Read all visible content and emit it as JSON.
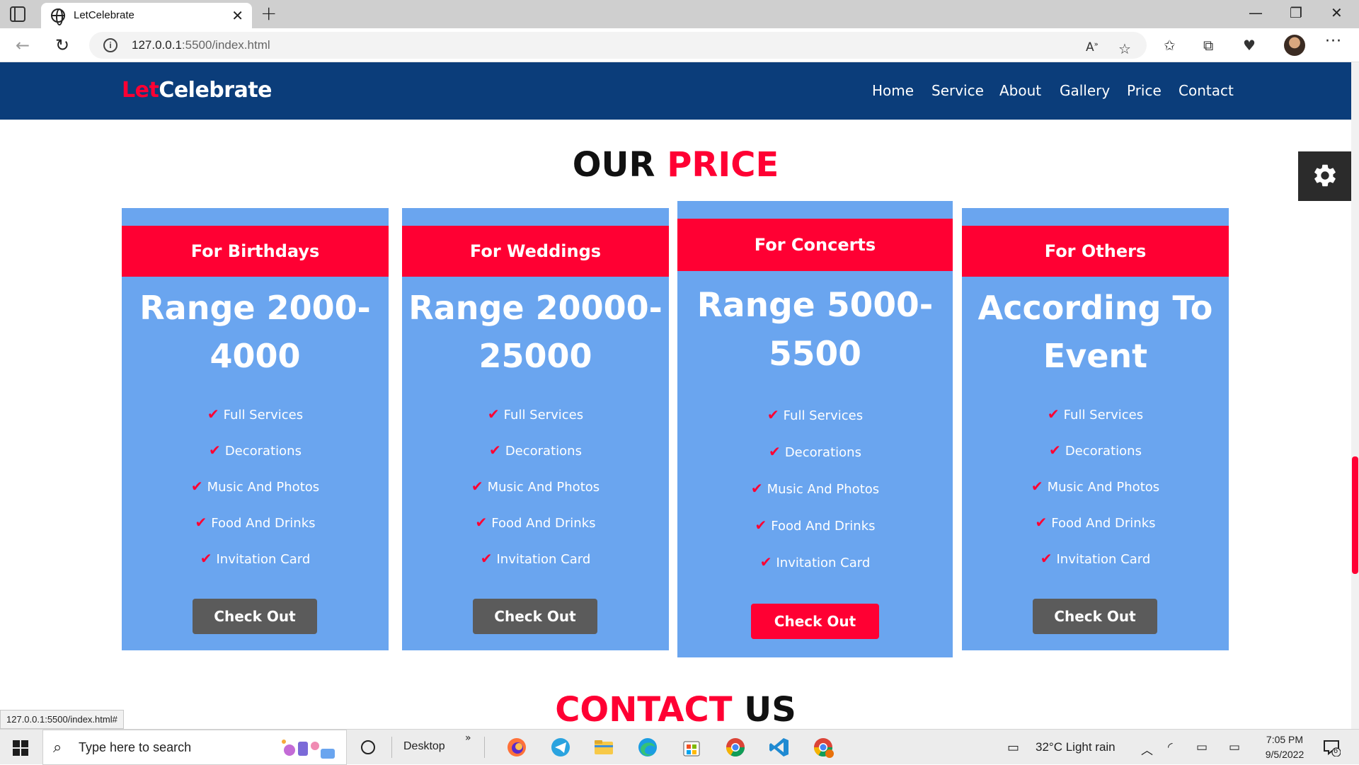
{
  "browser": {
    "tab_title": "LetCelebrate",
    "url_host": "127.0.0.1",
    "url_rest": ":5500/index.html",
    "status_url": "127.0.0.1:5500/index.html#"
  },
  "site": {
    "logo_accent": "Let",
    "logo_rest": "Celebrate",
    "nav": [
      "Home",
      "Service",
      "About",
      "Gallery",
      "Price",
      "Contact"
    ],
    "colors": {
      "header": "#0b3d7a",
      "accent": "#ff0033",
      "card": "#6aa5ef",
      "button": "#5b5b5b"
    }
  },
  "price_section": {
    "title_dark": "OUR",
    "title_red": "PRICE",
    "cards": [
      {
        "header": "For Birthdays",
        "range_line1": "Range 2000-",
        "range_line2": "4000",
        "features": [
          "Full Services",
          "Decorations",
          "Music And Photos",
          "Food And Drinks",
          "Invitation Card"
        ],
        "button": "Check Out"
      },
      {
        "header": "For Weddings",
        "range_line1": "Range 20000-",
        "range_line2": "25000",
        "features": [
          "Full Services",
          "Decorations",
          "Music And Photos",
          "Food And Drinks",
          "Invitation Card"
        ],
        "button": "Check Out"
      },
      {
        "header": "For Concerts",
        "range_line1": "Range 5000-",
        "range_line2": "5500",
        "features": [
          "Full Services",
          "Decorations",
          "Music And Photos",
          "Food And Drinks",
          "Invitation Card"
        ],
        "button": "Check Out"
      },
      {
        "header": "For Others",
        "range_line1": "According To",
        "range_line2": "Event",
        "features": [
          "Full Services",
          "Decorations",
          "Music And Photos",
          "Food And Drinks",
          "Invitation Card"
        ],
        "button": "Check Out"
      }
    ]
  },
  "contact_section": {
    "title_red": "CONTACT",
    "title_dark": "US"
  },
  "taskbar": {
    "search_placeholder": "Type here to search",
    "desktop_label": "Desktop",
    "weather": "32°C  Light rain",
    "time": "7:05 PM",
    "date": "9/5/2022",
    "notification_count": "6"
  }
}
